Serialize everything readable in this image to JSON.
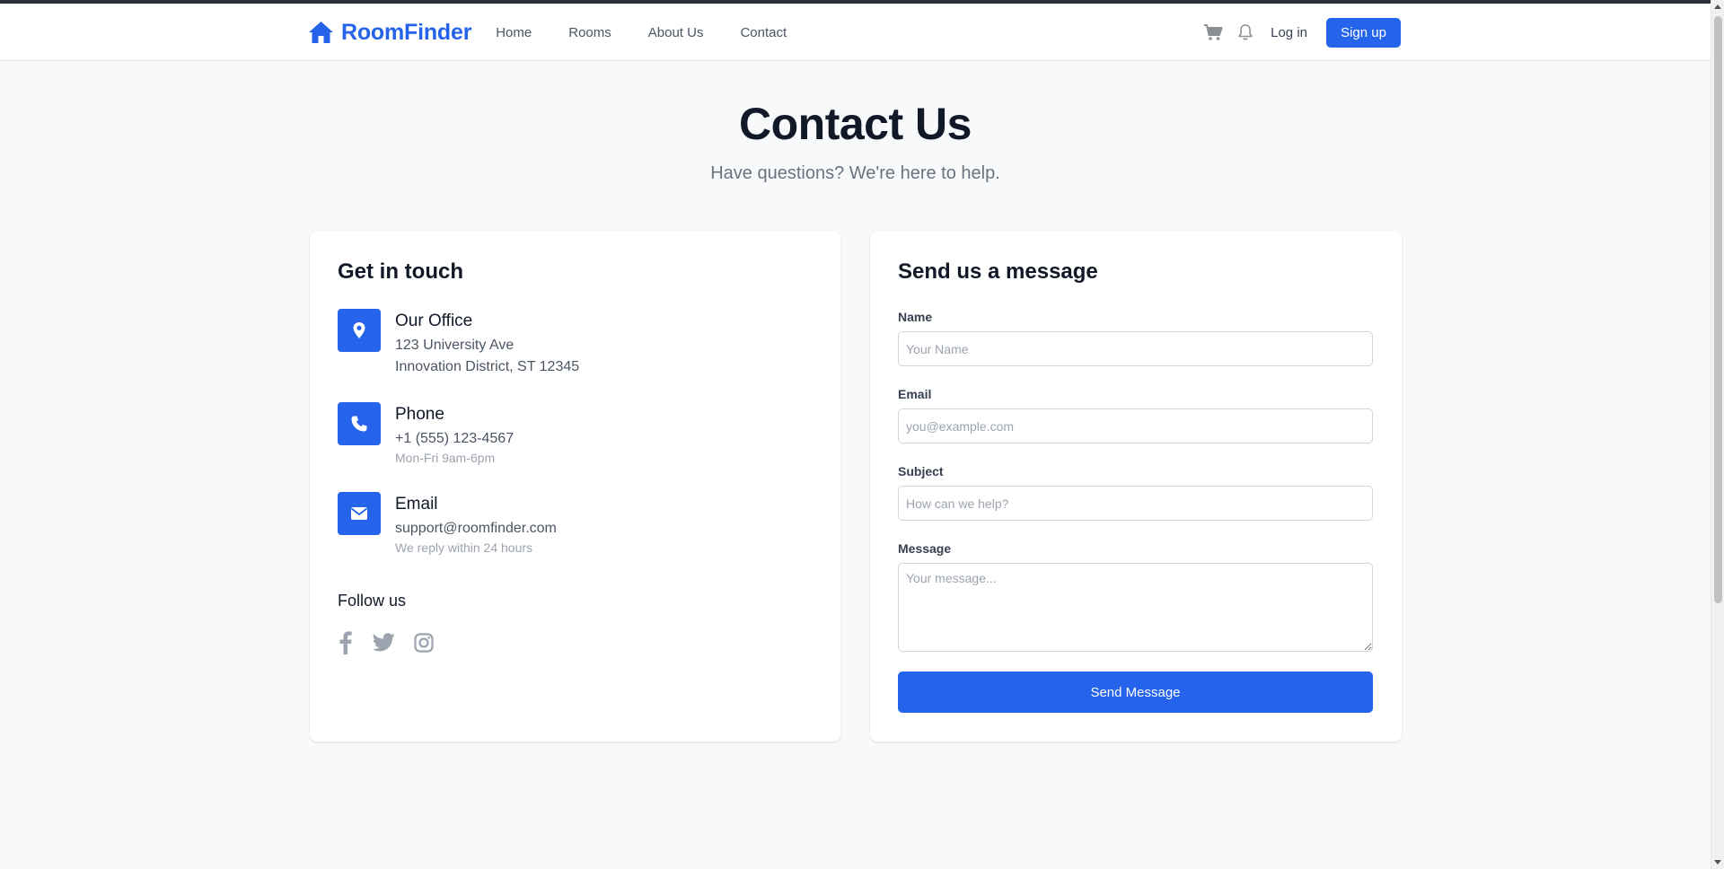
{
  "header": {
    "brand": "RoomFinder",
    "nav": [
      "Home",
      "Rooms",
      "About Us",
      "Contact"
    ],
    "login": "Log in",
    "signup": "Sign up"
  },
  "hero": {
    "title": "Contact Us",
    "subtitle": "Have questions? We're here to help."
  },
  "contact_info": {
    "title": "Get in touch",
    "office": {
      "title": "Our Office",
      "line1": "123 University Ave",
      "line2": "Innovation District, ST 12345",
      "icon": "map-pin-icon"
    },
    "phone": {
      "title": "Phone",
      "value": "+1 (555) 123-4567",
      "note": "Mon-Fri 9am-6pm",
      "icon": "phone-icon"
    },
    "email": {
      "title": "Email",
      "value": "support@roomfinder.com",
      "note": "We reply within 24 hours",
      "icon": "envelope-icon"
    },
    "follow_title": "Follow us",
    "socials": [
      "facebook-icon",
      "twitter-icon",
      "instagram-icon"
    ]
  },
  "form": {
    "title": "Send us a message",
    "name": {
      "label": "Name",
      "placeholder": "Your Name",
      "value": ""
    },
    "email": {
      "label": "Email",
      "placeholder": "you@example.com",
      "value": ""
    },
    "subject": {
      "label": "Subject",
      "placeholder": "How can we help?",
      "value": ""
    },
    "message": {
      "label": "Message",
      "placeholder": "Your message...",
      "value": ""
    },
    "submit": "Send Message"
  },
  "colors": {
    "accent": "#2563eb",
    "background": "#f8f9fb",
    "text": "#111827",
    "muted": "#6b7280"
  }
}
